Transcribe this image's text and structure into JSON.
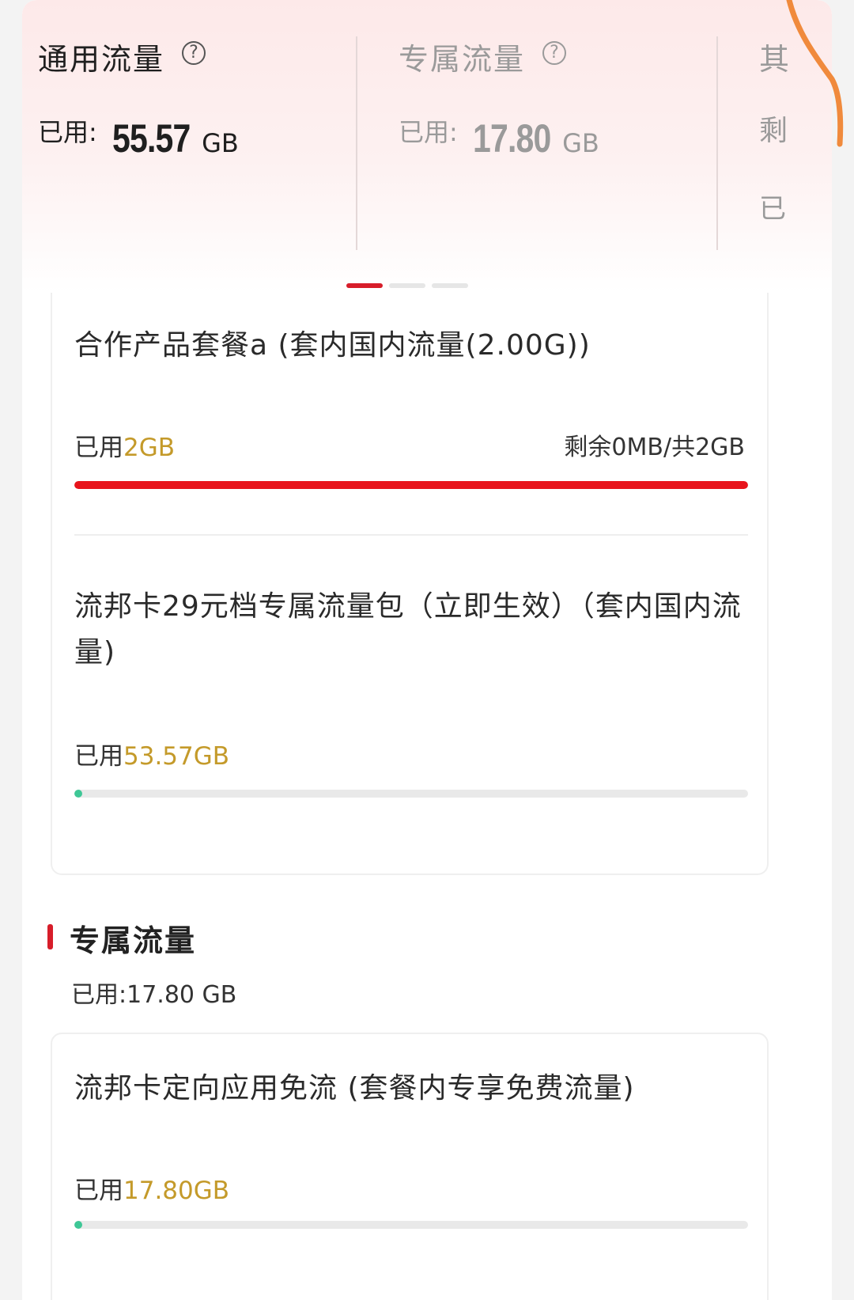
{
  "carousel": {
    "slides": [
      {
        "title": "通用流量",
        "used_label": "已用:",
        "used_value": "55.57",
        "unit": "GB",
        "active": true
      },
      {
        "title": "专属流量",
        "used_label": "已用:",
        "used_value": "17.80",
        "unit": "GB",
        "active": false
      },
      {
        "title": "其",
        "remain_label": "剩",
        "used_label": "已",
        "active": false
      }
    ],
    "page_index": 1,
    "page_count": 3
  },
  "general_packages": [
    {
      "name": "合作产品套餐a (套内国内流量(2.00G))",
      "used_label": "已用",
      "used_value": "2GB",
      "remain_text": "剩余0MB/共2GB",
      "progress": 1.0,
      "bar_color": "#e8141c"
    },
    {
      "name": "流邦卡29元档专属流量包（立即生效）（套内国内流量)",
      "used_label": "已用",
      "used_value": "53.57GB",
      "progress": 0.0,
      "bar_color": "#3ec796"
    }
  ],
  "exclusive": {
    "title": "专属流量",
    "used_text": "已用:17.80 GB",
    "packages": [
      {
        "name": "流邦卡定向应用免流 (套餐内专享免费流量)",
        "used_label": "已用",
        "used_value": "17.80GB",
        "progress": 0.0,
        "bar_color": "#3ec796"
      }
    ]
  },
  "icons": {
    "help": "question-circle-icon"
  },
  "colors": {
    "accent": "#d71d2a",
    "amount": "#c49a2a",
    "annotation": "#f08a3c"
  }
}
